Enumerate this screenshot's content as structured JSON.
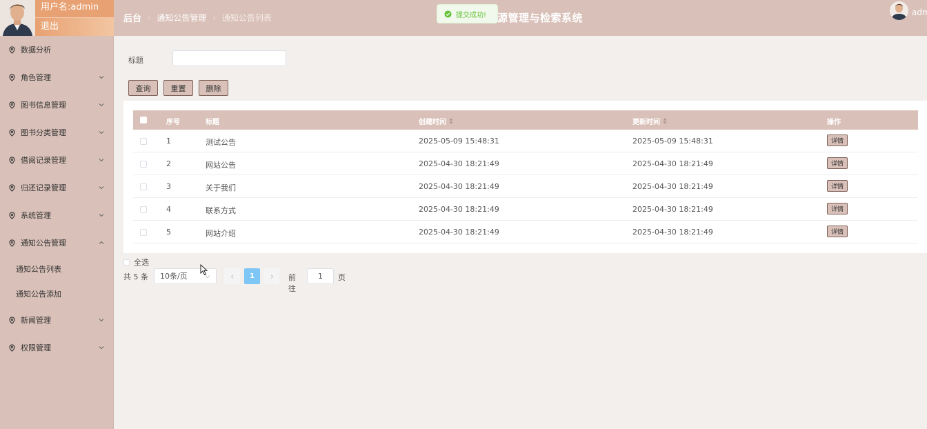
{
  "user": {
    "name_line": "用户名:admin",
    "logout": "退出"
  },
  "sidebar": {
    "items": [
      {
        "label": "数据分析"
      },
      {
        "label": "角色管理"
      },
      {
        "label": "图书信息管理"
      },
      {
        "label": "图书分类管理"
      },
      {
        "label": "借阅记录管理"
      },
      {
        "label": "归还记录管理"
      },
      {
        "label": "系统管理"
      },
      {
        "label": "通知公告管理"
      },
      {
        "label": "新闻管理"
      },
      {
        "label": "权限管理"
      }
    ],
    "sub_items": [
      {
        "label": "通知公告列表"
      },
      {
        "label": "通知公告添加"
      }
    ]
  },
  "header": {
    "crumbs": [
      "后台",
      "通知公告管理",
      "通知公告列表"
    ],
    "sys_title": "源管理与检索系统",
    "admin_name": "admin"
  },
  "toast": {
    "text": "提交成功!"
  },
  "search": {
    "label": "标题",
    "value": "",
    "query_btn": "查询",
    "reset_btn": "重置",
    "delete_btn": "删除"
  },
  "table": {
    "headers": {
      "index": "序号",
      "title": "标题",
      "created": "创建时间",
      "updated": "更新时间",
      "action": "操作"
    },
    "detail_label": "详情",
    "rows": [
      {
        "index": "1",
        "title": "测试公告",
        "created": "2025-05-09 15:48:31",
        "updated": "2025-05-09 15:48:31"
      },
      {
        "index": "2",
        "title": "网站公告",
        "created": "2025-04-30 18:21:49",
        "updated": "2025-04-30 18:21:49"
      },
      {
        "index": "3",
        "title": "关于我们",
        "created": "2025-04-30 18:21:49",
        "updated": "2025-04-30 18:21:49"
      },
      {
        "index": "4",
        "title": "联系方式",
        "created": "2025-04-30 18:21:49",
        "updated": "2025-04-30 18:21:49"
      },
      {
        "index": "5",
        "title": "网站介绍",
        "created": "2025-04-30 18:21:49",
        "updated": "2025-04-30 18:21:49"
      }
    ]
  },
  "footer": {
    "select_all": "全选",
    "total": "共 5 条",
    "page_size": "10条/页",
    "current_page": "1",
    "goto_prefix": "前往",
    "goto_value": "1",
    "goto_suffix": "页"
  },
  "colors": {
    "theme": "#d9c0b8",
    "accent_orange": "#e8a172",
    "success": "#67c23a",
    "pager_active": "#7ec6f5"
  }
}
